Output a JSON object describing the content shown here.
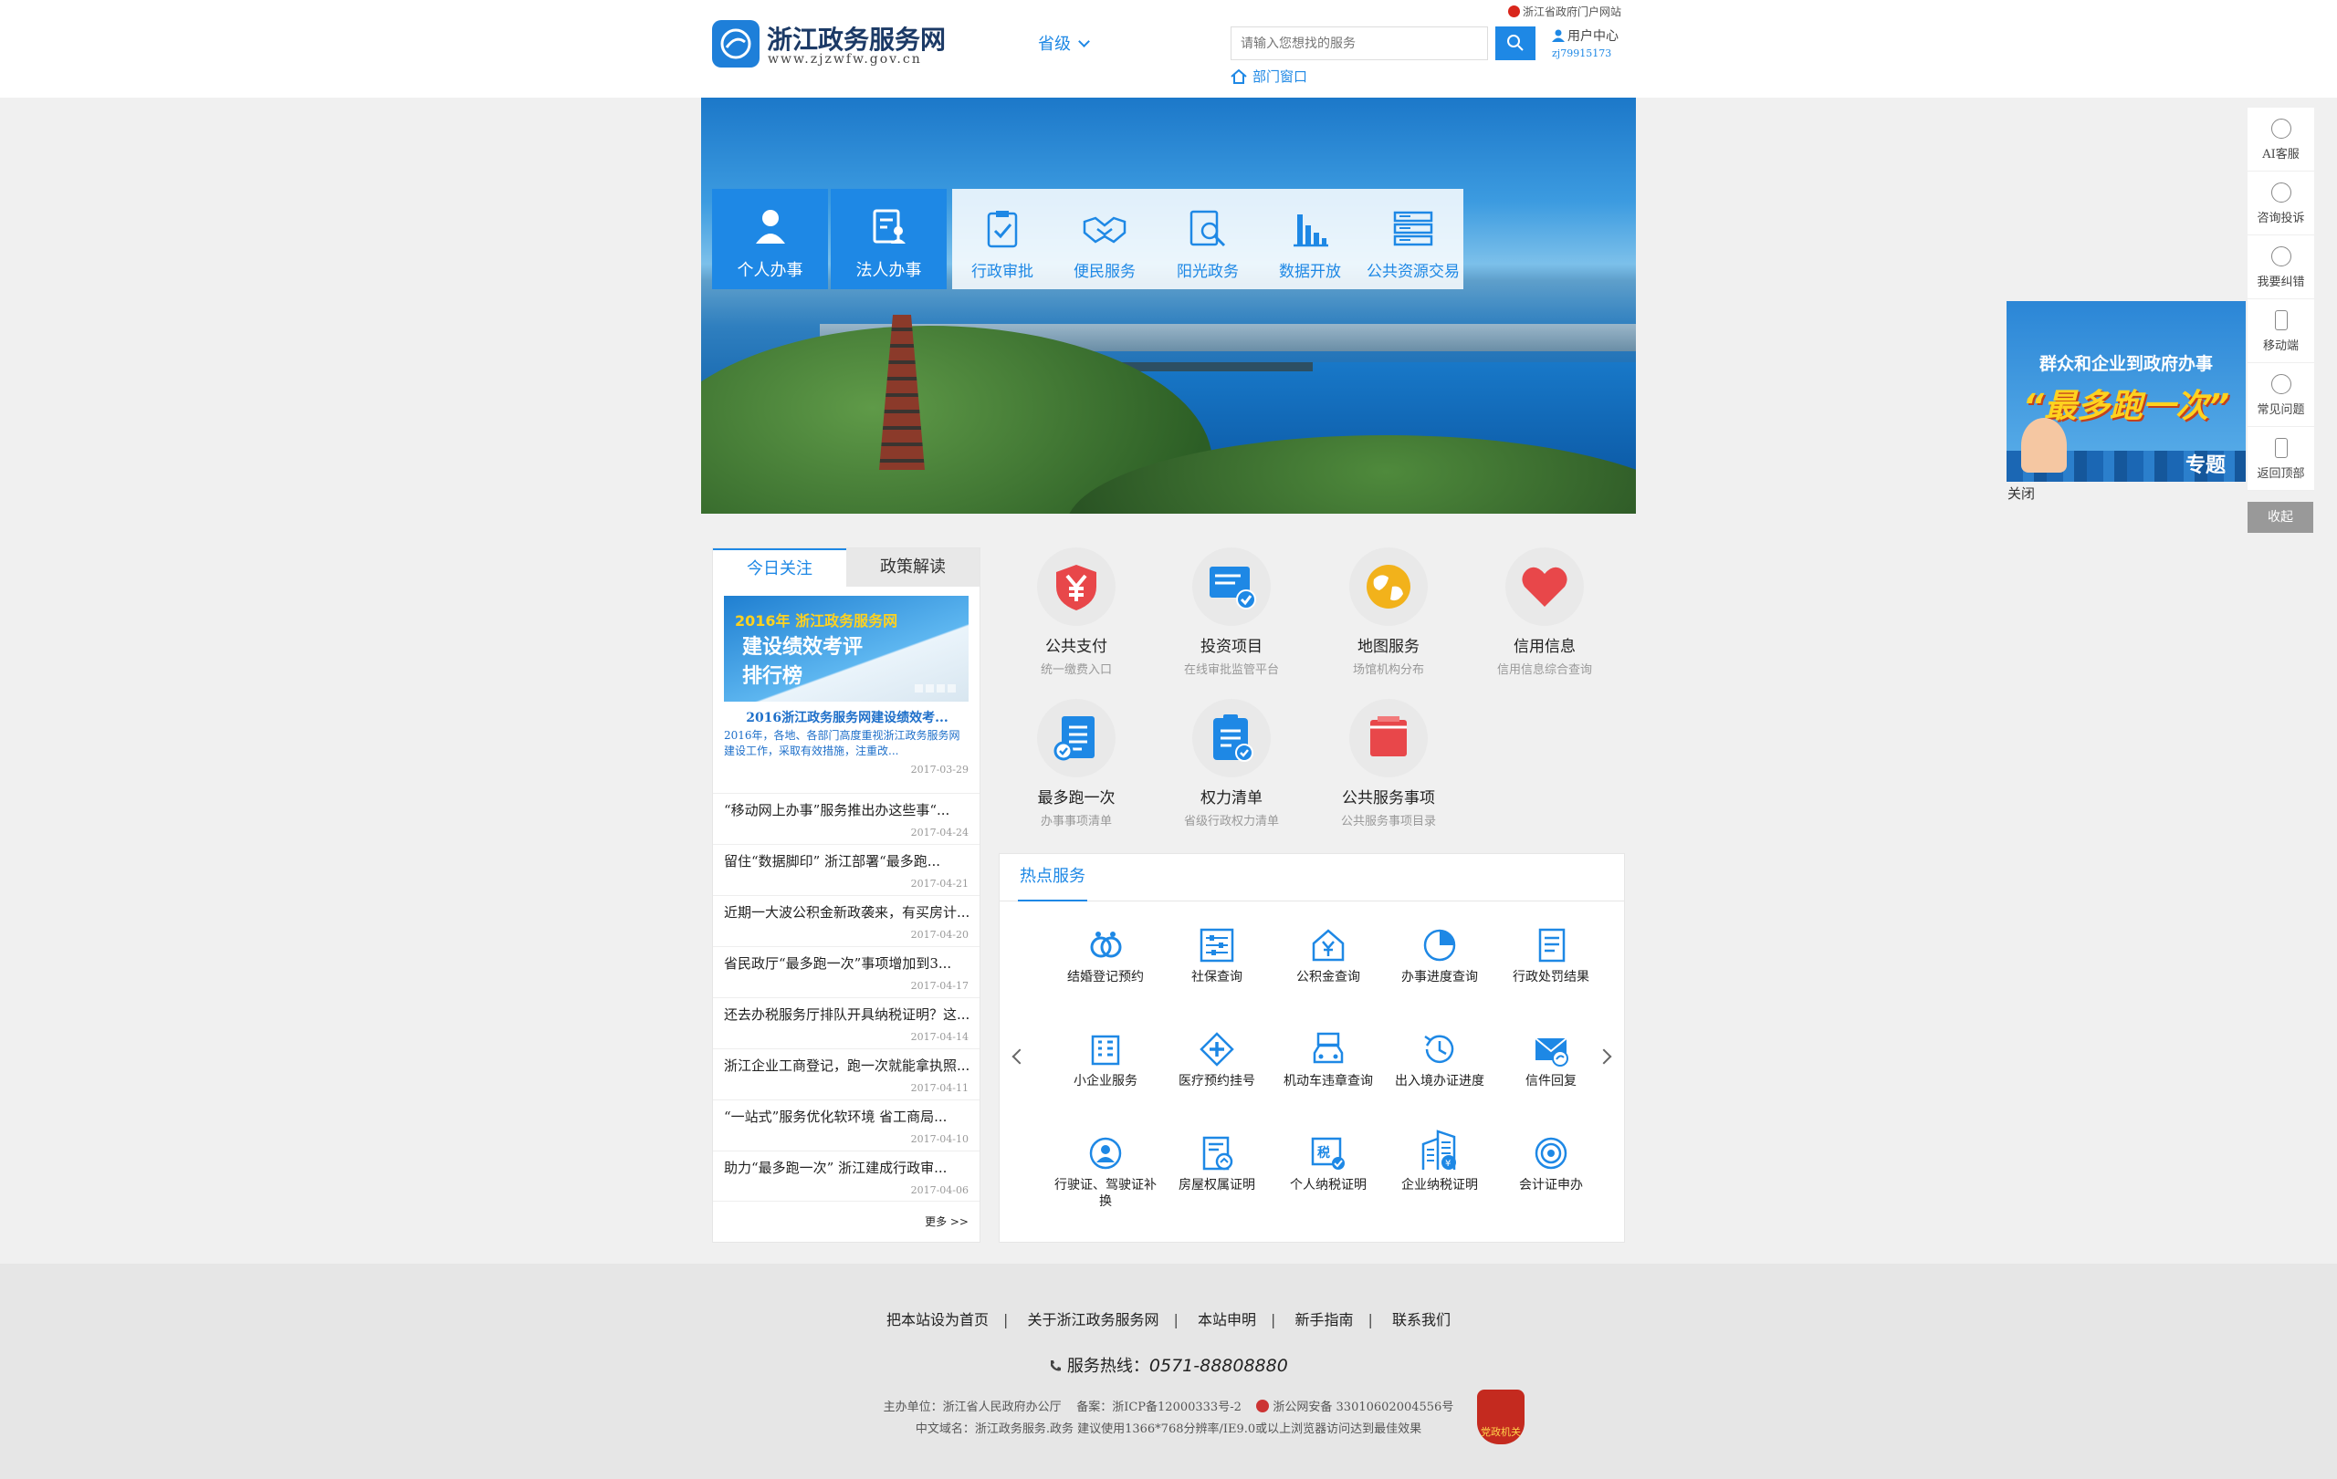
{
  "header": {
    "site_name": "浙江政务服务网",
    "site_url": "www.zjzwfw.gov.cn",
    "level": "省级",
    "search_placeholder": "请输入您想找的服务",
    "dept_window": "部门窗口",
    "portal_link": "浙江省政府门户网站",
    "user_center": "用户中心",
    "user_id": "zj79915173"
  },
  "banner": {
    "quick": [
      {
        "label": "个人办事"
      },
      {
        "label": "法人办事"
      }
    ],
    "services": [
      {
        "label": "行政审批",
        "icon": "clipboard-check-icon"
      },
      {
        "label": "便民服务",
        "icon": "handshake-icon"
      },
      {
        "label": "阳光政务",
        "icon": "document-search-icon"
      },
      {
        "label": "数据开放",
        "icon": "bar-chart-icon"
      },
      {
        "label": "公共资源交易",
        "icon": "server-stack-icon"
      }
    ]
  },
  "dock": {
    "items": [
      "AI客服",
      "咨询投诉",
      "我要纠错",
      "移动端",
      "常见问题",
      "返回顶部"
    ],
    "collapse": "收起"
  },
  "promo": {
    "line1": "群众和企业到政府办事",
    "line2": "“最多跑一次”",
    "line3": "专题",
    "close": "关闭"
  },
  "news": {
    "tabs": [
      "今日关注",
      "政策解读"
    ],
    "featured": {
      "img_year": "2016年 浙江政务服务网",
      "img_line1": "建设绩效考评",
      "img_line2": "排行榜",
      "title": "2016浙江政务服务网建设绩效考...",
      "desc": "2016年，各地、各部门高度重视浙江政务服务网建设工作，采取有效措施，注重改...",
      "date": "2017-03-29"
    },
    "items": [
      {
        "title": "“移动网上办事”服务推出办这些事“...",
        "date": "2017-04-24"
      },
      {
        "title": "留住“数据脚印” 浙江部署“最多跑...",
        "date": "2017-04-21"
      },
      {
        "title": "近期一大波公积金新政袭来，有买房计...",
        "date": "2017-04-20"
      },
      {
        "title": "省民政厅“最多跑一次”事项增加到3...",
        "date": "2017-04-17"
      },
      {
        "title": "还去办税服务厅排队开具纳税证明？这...",
        "date": "2017-04-14"
      },
      {
        "title": "浙江企业工商登记，跑一次就能拿执照...",
        "date": "2017-04-11"
      },
      {
        "title": "“一站式”服务优化软环境 省工商局...",
        "date": "2017-04-10"
      },
      {
        "title": "助力“最多跑一次” 浙江建成行政审...",
        "date": "2017-04-06"
      }
    ],
    "more": "更多 >>"
  },
  "apps": [
    {
      "name": "公共支付",
      "sub": "统一缴费入口",
      "icon": "yuan-shield-icon"
    },
    {
      "name": "投资项目",
      "sub": "在线审批监管平台",
      "icon": "monitor-check-icon"
    },
    {
      "name": "地图服务",
      "sub": "场馆机构分布",
      "icon": "globe-icon"
    },
    {
      "name": "信用信息",
      "sub": "信用信息综合查询",
      "icon": "heart-icon"
    },
    {
      "name": "最多跑一次",
      "sub": "办事事项清单",
      "icon": "checklist-icon"
    },
    {
      "name": "权力清单",
      "sub": "省级行政权力清单",
      "icon": "clipboard-list-icon"
    },
    {
      "name": "公共服务事项",
      "sub": "公共服务事项目录",
      "icon": "folder-icon"
    }
  ],
  "hot": {
    "title": "热点服务",
    "items": [
      "结婚登记预约",
      "社保查询",
      "公积金查询",
      "办事进度查询",
      "行政处罚结果",
      "小企业服务",
      "医疗预约挂号",
      "机动车违章查询",
      "出入境办证进度",
      "信件回复",
      "行驶证、驾驶证补换",
      "房屋权属证明",
      "个人纳税证明",
      "企业纳税证明",
      "会计证申办"
    ]
  },
  "footer": {
    "links": [
      "把本站设为首页",
      "关于浙江政务服务网",
      "本站申明",
      "新手指南",
      "联系我们"
    ],
    "hotline_label": "服务热线：",
    "hotline": "0571-88808880",
    "host": "主办单位：浙江省人民政府办公厅",
    "icp": "备案：浙ICP备12000333号-2",
    "police": "浙公网安备 33010602004556号",
    "info2": "中文域名：浙江政务服务.政务 建议使用1366*768分辨率/IE9.0或以上浏览器访问达到最佳效果",
    "party_badge": "党政机关"
  }
}
